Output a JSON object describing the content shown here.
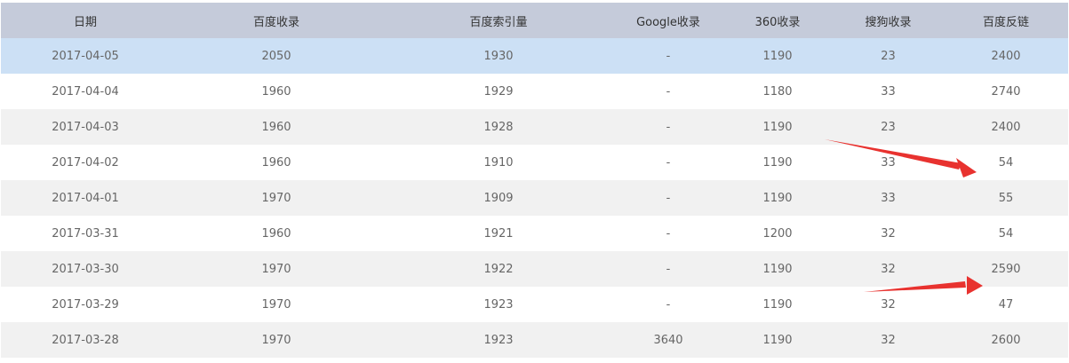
{
  "columns": [
    "日期",
    "百度收录",
    "百度索引量",
    "Google收录",
    "360收录",
    "搜狗收录",
    "百度反链"
  ],
  "rows": [
    [
      "2017-04-05",
      "2050",
      "1930",
      "-",
      "1190",
      "23",
      "2400"
    ],
    [
      "2017-04-04",
      "1960",
      "1929",
      "-",
      "1180",
      "33",
      "2740"
    ],
    [
      "2017-04-03",
      "1960",
      "1928",
      "-",
      "1190",
      "23",
      "2400"
    ],
    [
      "2017-04-02",
      "1960",
      "1910",
      "-",
      "1190",
      "33",
      "54"
    ],
    [
      "2017-04-01",
      "1970",
      "1909",
      "-",
      "1190",
      "33",
      "55"
    ],
    [
      "2017-03-31",
      "1960",
      "1921",
      "-",
      "1200",
      "32",
      "54"
    ],
    [
      "2017-03-30",
      "1970",
      "1922",
      "-",
      "1190",
      "32",
      "2590"
    ],
    [
      "2017-03-29",
      "1970",
      "1923",
      "-",
      "1190",
      "32",
      "47"
    ],
    [
      "2017-03-28",
      "1970",
      "1923",
      "3640",
      "1190",
      "32",
      "2600"
    ]
  ],
  "colors": {
    "header_bg": "#c5cbda",
    "highlight_row": "#cce0f5",
    "stripe_row": "#f1f1f1",
    "annotation_arrow": "#e8322f"
  },
  "annotations": [
    "arrow",
    "arrow"
  ]
}
